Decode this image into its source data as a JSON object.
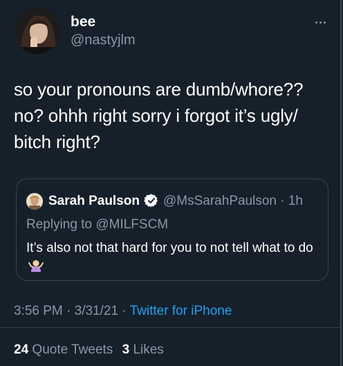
{
  "tweet": {
    "display_name": "bee",
    "handle": "@nastyjlm",
    "text": "so your pronouns are dumb/whore??\nno? ohhh right sorry i forgot it’s ugly/\nbitch right?",
    "more_icon": "more-horizontal-icon"
  },
  "quote": {
    "display_name": "Sarah Paulson",
    "verified_icon": "verified-badge-icon",
    "handle_time": "@MsSarahPaulson · 1h",
    "replying_prefix": "Replying to",
    "replying_to": "@MILFSCM",
    "text": "It’s also not that hard for you to not tell what to do",
    "emoji": "person-shrugging-emoji"
  },
  "meta": {
    "timestamp": "3:56 PM · 3/31/21 · ",
    "source": "Twitter for iPhone"
  },
  "stats": {
    "quote_count": "24",
    "quote_label": "Quote Tweets",
    "like_count": "3",
    "like_label": "Likes"
  },
  "colors": {
    "background": "#15202b",
    "secondary_text": "#8899a6",
    "link": "#1da1f2",
    "border": "#38444d"
  }
}
